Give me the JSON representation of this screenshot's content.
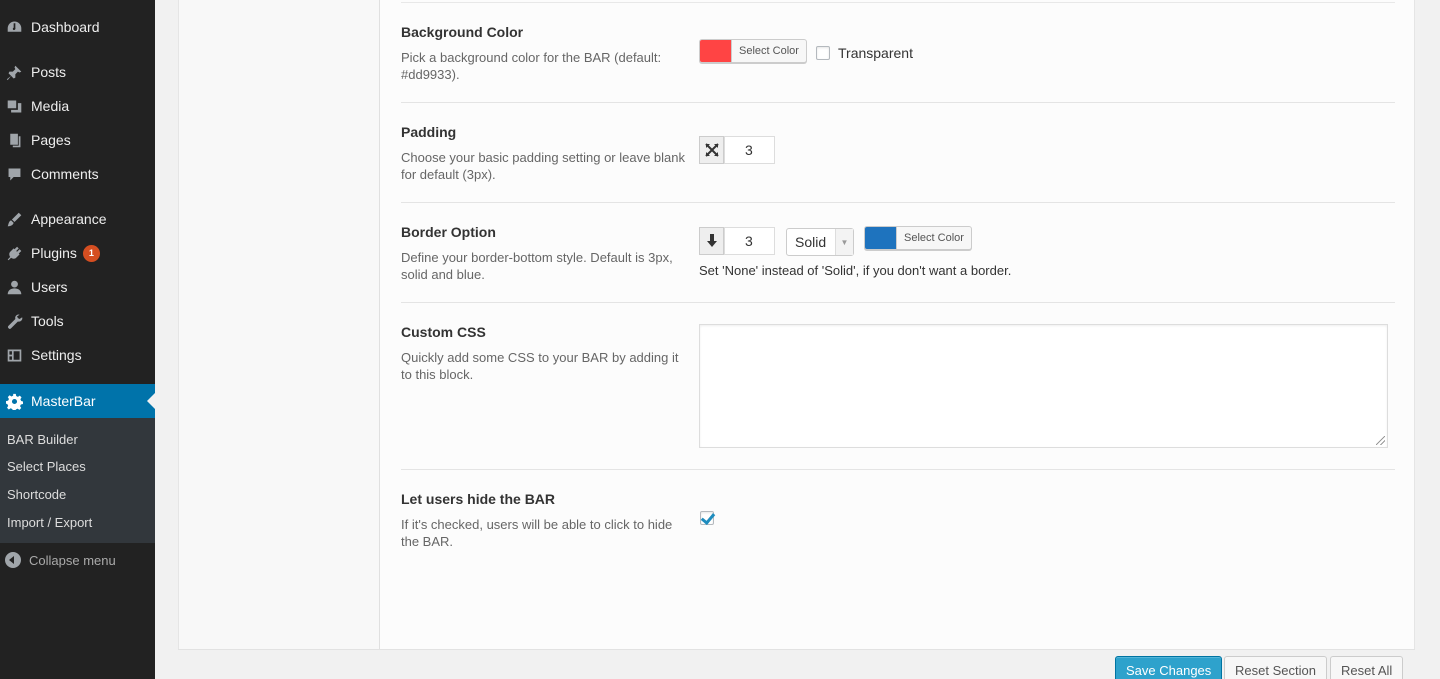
{
  "sidebar": {
    "items": [
      {
        "label": "Dashboard",
        "icon": "dashboard-icon"
      },
      {
        "label": "Posts",
        "icon": "pin-icon"
      },
      {
        "label": "Media",
        "icon": "media-icon"
      },
      {
        "label": "Pages",
        "icon": "pages-icon"
      },
      {
        "label": "Comments",
        "icon": "comment-icon"
      },
      {
        "label": "Appearance",
        "icon": "brush-icon"
      },
      {
        "label": "Plugins",
        "icon": "plugin-icon",
        "badge": "1"
      },
      {
        "label": "Users",
        "icon": "user-icon"
      },
      {
        "label": "Tools",
        "icon": "wrench-icon"
      },
      {
        "label": "Settings",
        "icon": "settings-icon"
      },
      {
        "label": "MasterBar",
        "icon": "gear-icon",
        "active": true
      }
    ],
    "submenu": [
      "BAR Builder",
      "Select Places",
      "Shortcode",
      "Import / Export"
    ],
    "collapse_label": "Collapse menu"
  },
  "options": {
    "background": {
      "title": "Background Color",
      "desc": "Pick a background color for the BAR (default: #dd9933).",
      "button_label": "Select Color",
      "swatch_color": "#ff4444",
      "transparent_label": "Transparent",
      "transparent_checked": false
    },
    "padding": {
      "title": "Padding",
      "desc": "Choose your basic padding setting or leave blank for default (3px).",
      "value": "3",
      "icon": "arrows-expand-icon"
    },
    "border": {
      "title": "Border Option",
      "desc": "Define your border-bottom style. Default is 3px, solid and blue.",
      "width_value": "3",
      "icon": "arrow-down-icon",
      "style_value": "Solid",
      "color_button_label": "Select Color",
      "swatch_color": "#1e73be",
      "hint": "Set 'None' instead of 'Solid', if you don't want a border."
    },
    "css": {
      "title": "Custom CSS",
      "desc": "Quickly add some CSS to your BAR by adding it to this block.",
      "value": ""
    },
    "hide": {
      "title": "Let users hide the BAR",
      "desc": "If it's checked, users will be able to click to hide the BAR.",
      "checked": true
    }
  },
  "footer": {
    "save_label": "Save Changes",
    "reset_section_label": "Reset Section",
    "reset_all_label": "Reset All"
  },
  "colors": {
    "sidebar_bg": "#222222",
    "submenu_bg": "#32373c",
    "active": "#0073aa",
    "primary_button": "#2ea2cc",
    "badge": "#d54e21"
  }
}
